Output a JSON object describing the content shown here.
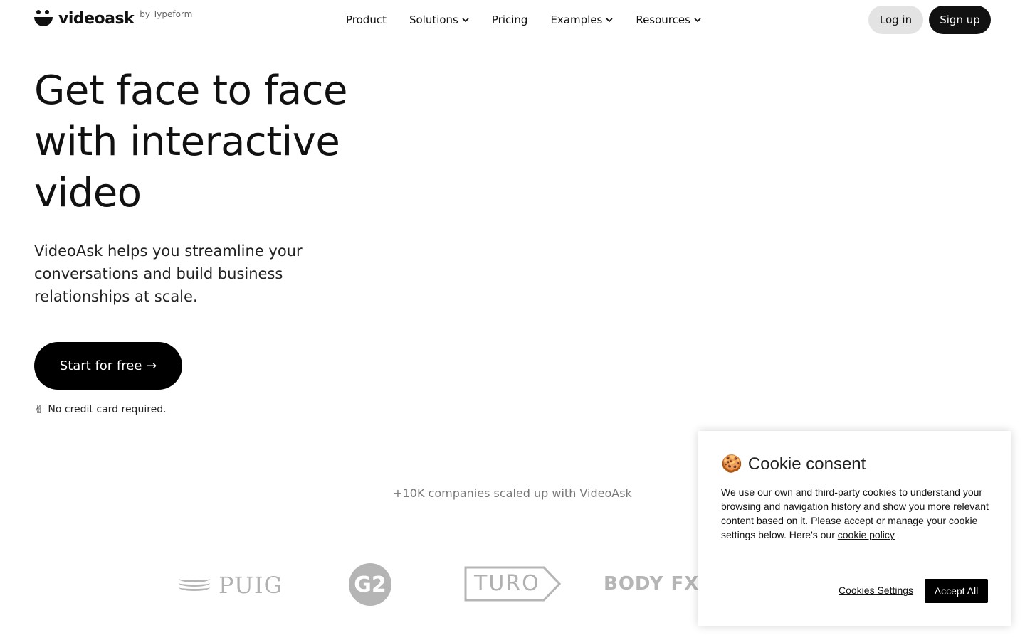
{
  "nav": {
    "logo_text": "videoask",
    "logo_by": "by Typeform",
    "items": [
      {
        "label": "Product",
        "has_dropdown": false
      },
      {
        "label": "Solutions",
        "has_dropdown": true
      },
      {
        "label": "Pricing",
        "has_dropdown": false
      },
      {
        "label": "Examples",
        "has_dropdown": true
      },
      {
        "label": "Resources",
        "has_dropdown": true
      }
    ],
    "login_label": "Log in",
    "signup_label": "Sign up"
  },
  "hero": {
    "title": "Get face to face with interactive video",
    "subtitle": "VideoAsk helps you streamline your conversations and build business relationships at scale.",
    "cta_label": "Start for free →",
    "no_credit_emoji": "✌",
    "no_credit_text": "No credit card required."
  },
  "social_proof": {
    "text": "+10K companies scaled up with VideoAsk",
    "logos": [
      {
        "name": "PUIG",
        "icon": "puig-logo"
      },
      {
        "name": "G2",
        "icon": "g2-logo"
      },
      {
        "name": "TURO",
        "icon": "turo-logo"
      },
      {
        "name": "BODY FX",
        "icon": "bodyfx-logo"
      }
    ]
  },
  "cookie": {
    "emoji": "🍪",
    "title": "Cookie consent",
    "body": "We use our own and third-party cookies to understand your browsing and navigation history and show you more relevant content based on it. Please accept or manage your cookie settings below. Here's our",
    "link_label": "cookie policy",
    "settings_label": "Cookies Settings",
    "accept_label": "Accept All"
  },
  "colors": {
    "primary": "#111111",
    "login_bg": "#e3e3e3",
    "logo_gray": "#b0b0b0"
  }
}
